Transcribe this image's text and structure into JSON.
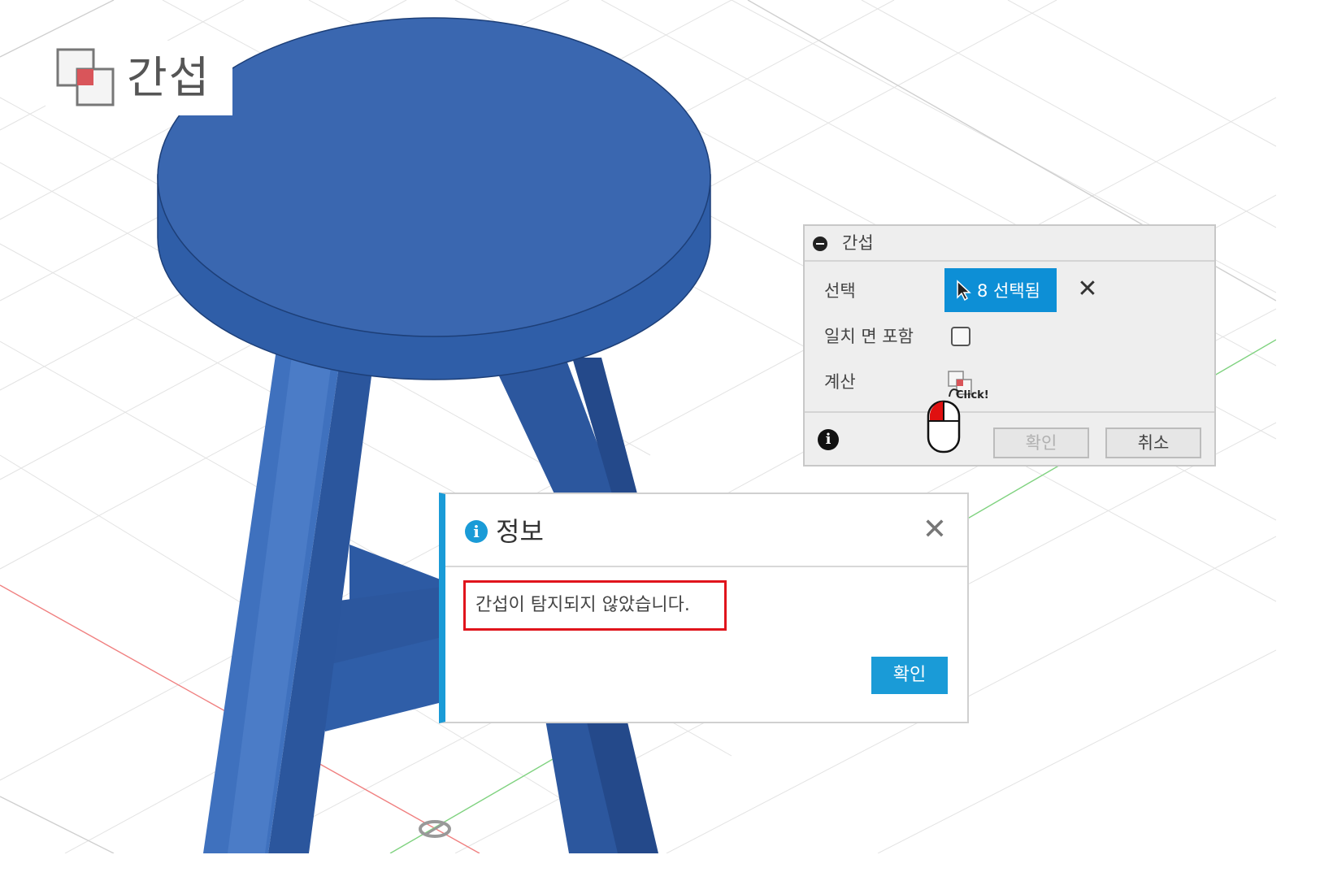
{
  "tool": {
    "title": "간섭",
    "icon": "interference-icon"
  },
  "panel": {
    "title": "간섭",
    "select_label": "선택",
    "select_button": "8 선택됨",
    "coplanar_label": "일치 면 포함",
    "coplanar_checked": false,
    "compute_label": "계산",
    "ok_button": "확인",
    "cancel_button": "취소",
    "colors": {
      "accent": "#0d8fd6",
      "panel_bg": "#eeeeee"
    }
  },
  "hint": {
    "click_text": "Click!"
  },
  "dialog": {
    "title": "정보",
    "message": "간섭이 탐지되지 않았습니다.",
    "ok_button": "확인",
    "colors": {
      "accent": "#1a9bd7",
      "highlight": "#e0141c"
    }
  },
  "scene": {
    "model_color": "#3a67b0",
    "object": "stool"
  }
}
